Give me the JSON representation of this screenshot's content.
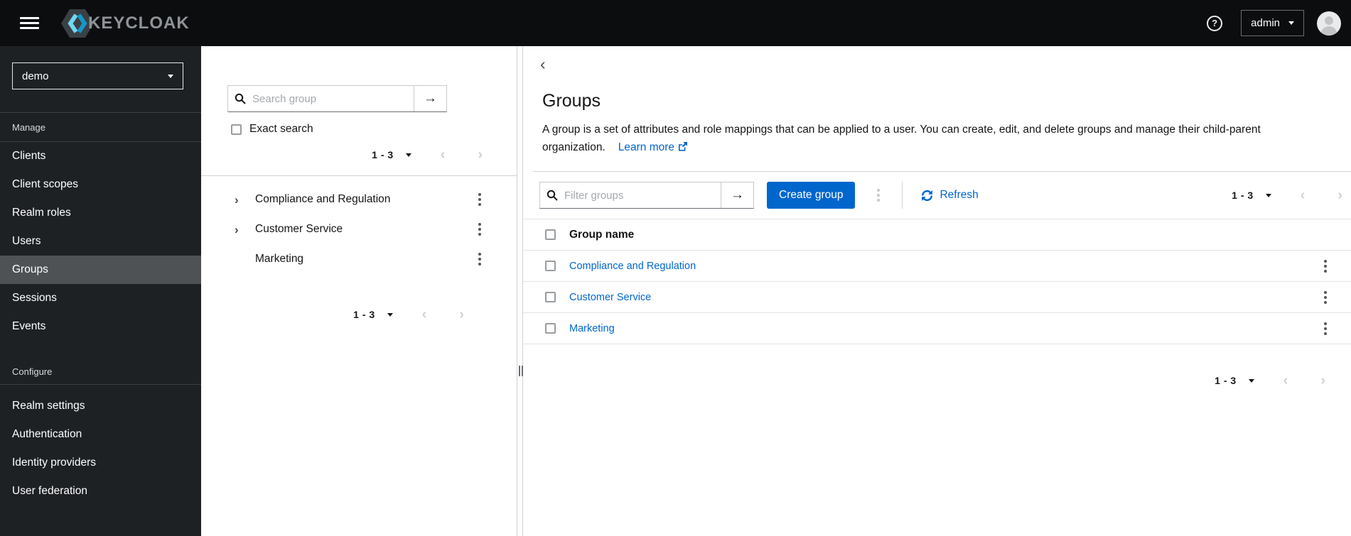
{
  "masthead": {
    "brand": "KEYCLOAK",
    "help": "?",
    "user": "admin"
  },
  "sidebar": {
    "realm": "demo",
    "manage_label": "Manage",
    "manage_items": [
      "Clients",
      "Client scopes",
      "Realm roles",
      "Users",
      "Groups",
      "Sessions",
      "Events"
    ],
    "configure_label": "Configure",
    "configure_items": [
      "Realm settings",
      "Authentication",
      "Identity providers",
      "User federation"
    ],
    "selected_item": "Groups"
  },
  "tree_panel": {
    "search_placeholder": "Search group",
    "search_value": "",
    "exact_search_label": "Exact search",
    "pagination_top": "1 - 3",
    "pagination_bottom": "1 - 3",
    "items": [
      {
        "name": "Compliance and Regulation",
        "expandable": true
      },
      {
        "name": "Customer Service",
        "expandable": true
      },
      {
        "name": "Marketing",
        "expandable": false
      }
    ]
  },
  "main": {
    "title": "Groups",
    "description": "A group is a set of attributes and role mappings that can be applied to a user. You can create, edit, and delete groups and manage their child-parent organization.",
    "learn_more_label": "Learn more",
    "toolbar": {
      "filter_placeholder": "Filter groups",
      "filter_value": "",
      "create_button_label": "Create group",
      "refresh_label": "Refresh",
      "pagination": "1 - 3"
    },
    "table": {
      "column_header": "Group name",
      "rows": [
        "Compliance and Regulation",
        "Customer Service",
        "Marketing"
      ],
      "pagination": "1 - 3"
    }
  },
  "colors": {
    "primary_blue": "#0066cc",
    "link_blue": "#0066cc",
    "masthead_bg": "#0b0d0f",
    "sidebar_bg": "#1e2124",
    "selected_nav_bg": "#4f5255",
    "logo_cyan_light": "#6fd8f0",
    "logo_cyan_dark": "#1597c8"
  }
}
